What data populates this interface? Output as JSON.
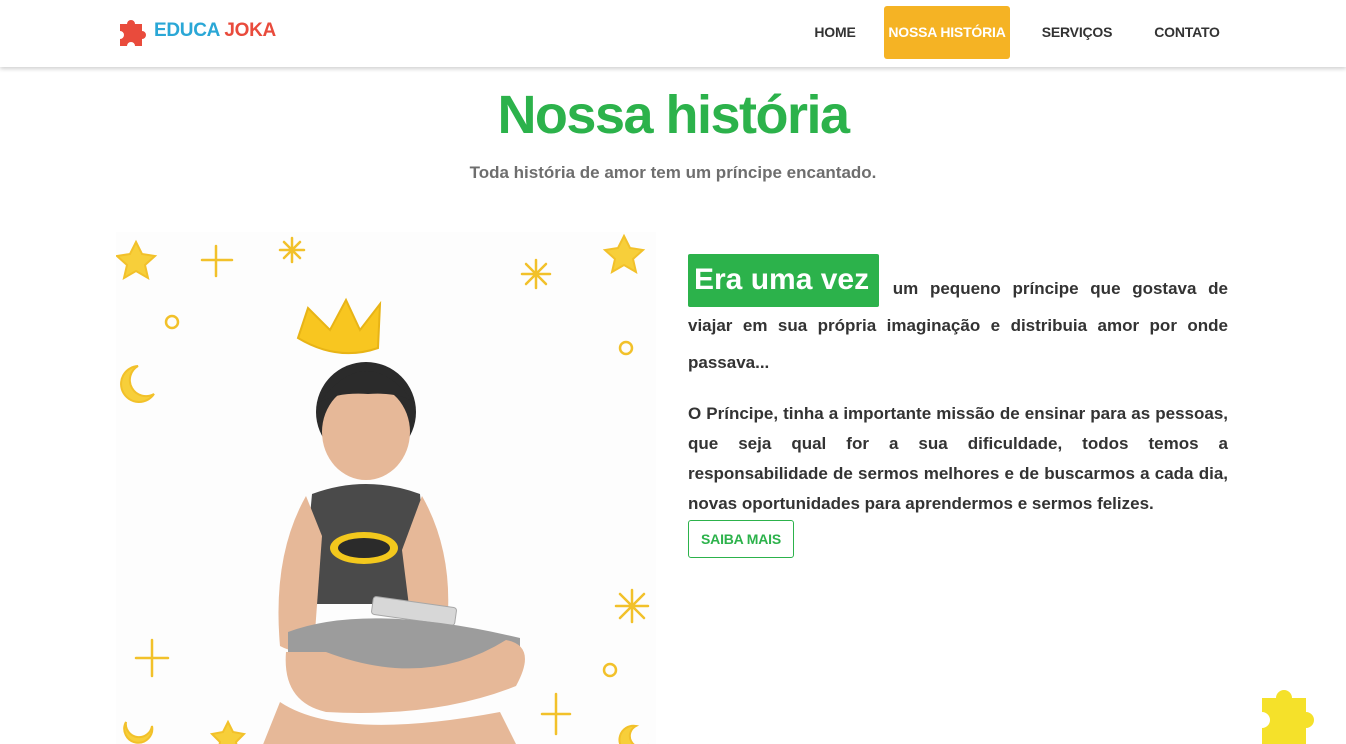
{
  "brand": {
    "word1": "EDUCA",
    "word2": "JOKA",
    "icon": "puzzle-piece-icon",
    "colors": {
      "word1": "#2aa7d6",
      "word2": "#e94b3c",
      "icon": "#e94b3c"
    }
  },
  "nav": {
    "items": [
      {
        "label": "HOME",
        "active": false
      },
      {
        "label": "NOSSA HISTÓRIA",
        "active": true
      },
      {
        "label": "SERVIÇOS",
        "active": false
      },
      {
        "label": "CONTATO",
        "active": false
      }
    ],
    "active_color": "#f5b324"
  },
  "hero": {
    "title": "Nossa história",
    "subtitle": "Toda história de amor tem um príncipe encantado."
  },
  "story": {
    "highlight": "Era uma vez",
    "paragraph1_rest": "um pequeno príncipe que gostava de viajar em sua própria imaginação e distribuia amor por onde passava...",
    "paragraph2": "O Príncipe, tinha a importante missão de ensinar para as pessoas, que seja qual for a sua dificuldade, todos temos a responsabilidade de sermos melhores e de buscarmos a cada dia, novas oportunidades para aprendermos e sermos felizes.",
    "cta": "SAIBA MAIS"
  },
  "colors": {
    "accent_green": "#2cb24b",
    "accent_yellow": "#f5b324",
    "float_puzzle": "#f5e12a"
  }
}
